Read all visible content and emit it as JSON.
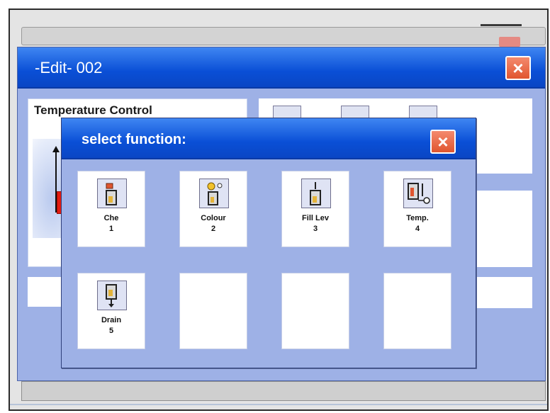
{
  "edit_window": {
    "title": "-Edit- 002",
    "close_label": "×",
    "panel_title": "Temperature Control"
  },
  "dialog": {
    "title": "select function:",
    "close_label": "×",
    "functions": [
      {
        "name": "Che",
        "number": "1",
        "icon": "chemical-dosing-icon"
      },
      {
        "name": "Colour",
        "number": "2",
        "icon": "colour-dosing-icon"
      },
      {
        "name": "Fill Lev",
        "number": "3",
        "icon": "fill-level-icon"
      },
      {
        "name": "Temp.",
        "number": "4",
        "icon": "temperature-icon"
      },
      {
        "name": "Drain",
        "number": "5",
        "icon": "drain-icon"
      }
    ]
  },
  "colors": {
    "titlebar_blue": "#0a4fd6",
    "panel_blue": "#9eb1e6",
    "close_red": "#e0552f",
    "indicator_red": "#e31b10"
  }
}
